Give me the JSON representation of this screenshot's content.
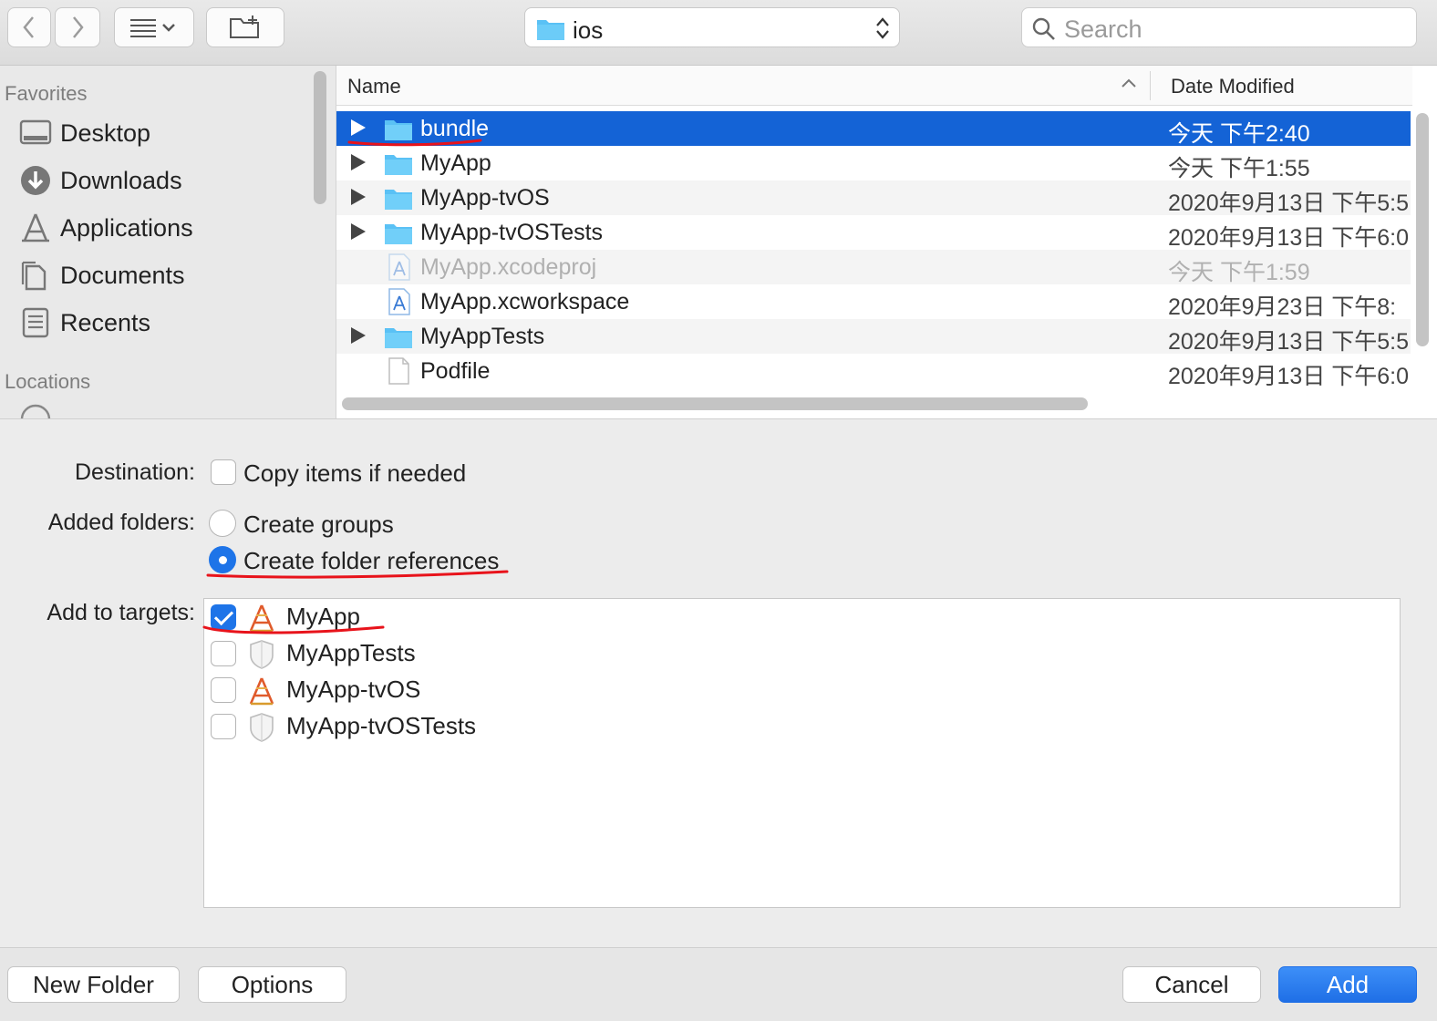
{
  "toolbar": {
    "back_label": "<",
    "forward_label": ">",
    "path": "ios",
    "search_placeholder": "Search"
  },
  "sidebar": {
    "favorites_heading": "Favorites",
    "items": [
      {
        "label": "Desktop",
        "icon": "desktop-icon"
      },
      {
        "label": "Downloads",
        "icon": "downloads-icon"
      },
      {
        "label": "Applications",
        "icon": "applications-icon"
      },
      {
        "label": "Documents",
        "icon": "documents-icon"
      },
      {
        "label": "Recents",
        "icon": "recents-icon"
      }
    ],
    "locations_heading": "Locations"
  },
  "filelist": {
    "col_name": "Name",
    "col_date": "Date Modified",
    "sort_indicator": "^",
    "rows": [
      {
        "name": "bundle",
        "date": "今天 下午2:40",
        "type": "folder",
        "expandable": true,
        "selected": true
      },
      {
        "name": "MyApp",
        "date": "今天 下午1:55",
        "type": "folder",
        "expandable": true
      },
      {
        "name": "MyApp-tvOS",
        "date": "2020年9月13日 下午5:5",
        "type": "folder",
        "expandable": true
      },
      {
        "name": "MyApp-tvOSTests",
        "date": "2020年9月13日 下午6:0",
        "type": "folder",
        "expandable": true
      },
      {
        "name": "MyApp.xcodeproj",
        "date": "今天 下午1:59",
        "type": "xcodeproj",
        "dimmed": true
      },
      {
        "name": "MyApp.xcworkspace",
        "date": "2020年9月23日 下午8:",
        "type": "xcworkspace"
      },
      {
        "name": "MyAppTests",
        "date": "2020年9月13日 下午5:5",
        "type": "folder",
        "expandable": true
      },
      {
        "name": "Podfile",
        "date": "2020年9月13日 下午6:0",
        "type": "file"
      }
    ]
  },
  "options": {
    "destination_label": "Destination:",
    "copy_items_label": "Copy items if needed",
    "copy_items_checked": false,
    "added_folders_label": "Added folders:",
    "create_groups_label": "Create groups",
    "create_refs_label": "Create folder references",
    "selected_option": "Create folder references",
    "targets_label": "Add to targets:",
    "targets": [
      {
        "name": "MyApp",
        "checked": true,
        "icon": "app-target-icon"
      },
      {
        "name": "MyAppTests",
        "checked": false,
        "icon": "test-target-icon"
      },
      {
        "name": "MyApp-tvOS",
        "checked": false,
        "icon": "app-target-icon"
      },
      {
        "name": "MyApp-tvOSTests",
        "checked": false,
        "icon": "test-target-icon"
      }
    ]
  },
  "buttons": {
    "new_folder": "New Folder",
    "options": "Options",
    "cancel": "Cancel",
    "add": "Add"
  },
  "colors": {
    "accent": "#1e74e8",
    "selection": "#1463d6",
    "annotation": "#e8131b",
    "folder": "#5ac1f5"
  }
}
